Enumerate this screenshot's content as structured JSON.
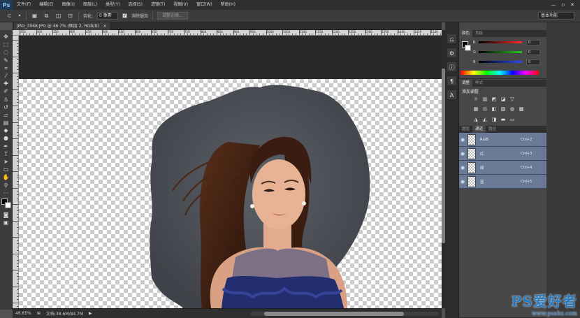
{
  "app": {
    "logo": "Ps"
  },
  "menu": [
    "文件(F)",
    "编辑(E)",
    "图像(I)",
    "图层(L)",
    "类型(Y)",
    "选择(S)",
    "滤镜(T)",
    "视图(V)",
    "窗口(W)",
    "帮助(H)"
  ],
  "window_controls": {
    "minimize": "—",
    "restore": "▫",
    "close": "✕"
  },
  "options": {
    "feather_label": "羽化:",
    "feather_value": "0 像素",
    "antialias_label": "消除锯齿",
    "refine_button": "调整边缘...",
    "workspace": "基本功能"
  },
  "document": {
    "tab_title": "JMG_3968.JPG @ 46.7% (图层 2, RGB/8)",
    "tab_close": "×"
  },
  "ruler_labels": [
    "250",
    "300",
    "350",
    "400",
    "450",
    "500",
    "550",
    "600",
    "650",
    "700",
    "750",
    "800",
    "850",
    "900",
    "950",
    "1000",
    "1050",
    "1100",
    "1150",
    "1200",
    "1250",
    "1300",
    "1350",
    "1400",
    "1450",
    "1500"
  ],
  "status": {
    "zoom": "46.65%",
    "doc_info": "文档:38.6M/84.7M",
    "arrow": "▶"
  },
  "color_panel": {
    "tabs": [
      "颜色",
      "色板"
    ],
    "channels": [
      {
        "label": "R",
        "value": "0",
        "color": "#ff2a2a"
      },
      {
        "label": "G",
        "value": "0",
        "color": "#22cc22"
      },
      {
        "label": "B",
        "value": "0",
        "color": "#2a4cff"
      }
    ]
  },
  "adjust_panel": {
    "tabs": [
      "调整",
      "样式"
    ],
    "title": "添加调整"
  },
  "channels_panel": {
    "tabs": [
      "图层",
      "通道",
      "路径"
    ],
    "channels": [
      {
        "name": "RGB",
        "shortcut": "Ctrl+2"
      },
      {
        "name": "红",
        "shortcut": "Ctrl+3"
      },
      {
        "name": "绿",
        "shortcut": "Ctrl+4"
      },
      {
        "name": "蓝",
        "shortcut": "Ctrl+5"
      }
    ]
  },
  "watermark": {
    "text": "PS爱好者",
    "url": "www.psahz.com"
  }
}
